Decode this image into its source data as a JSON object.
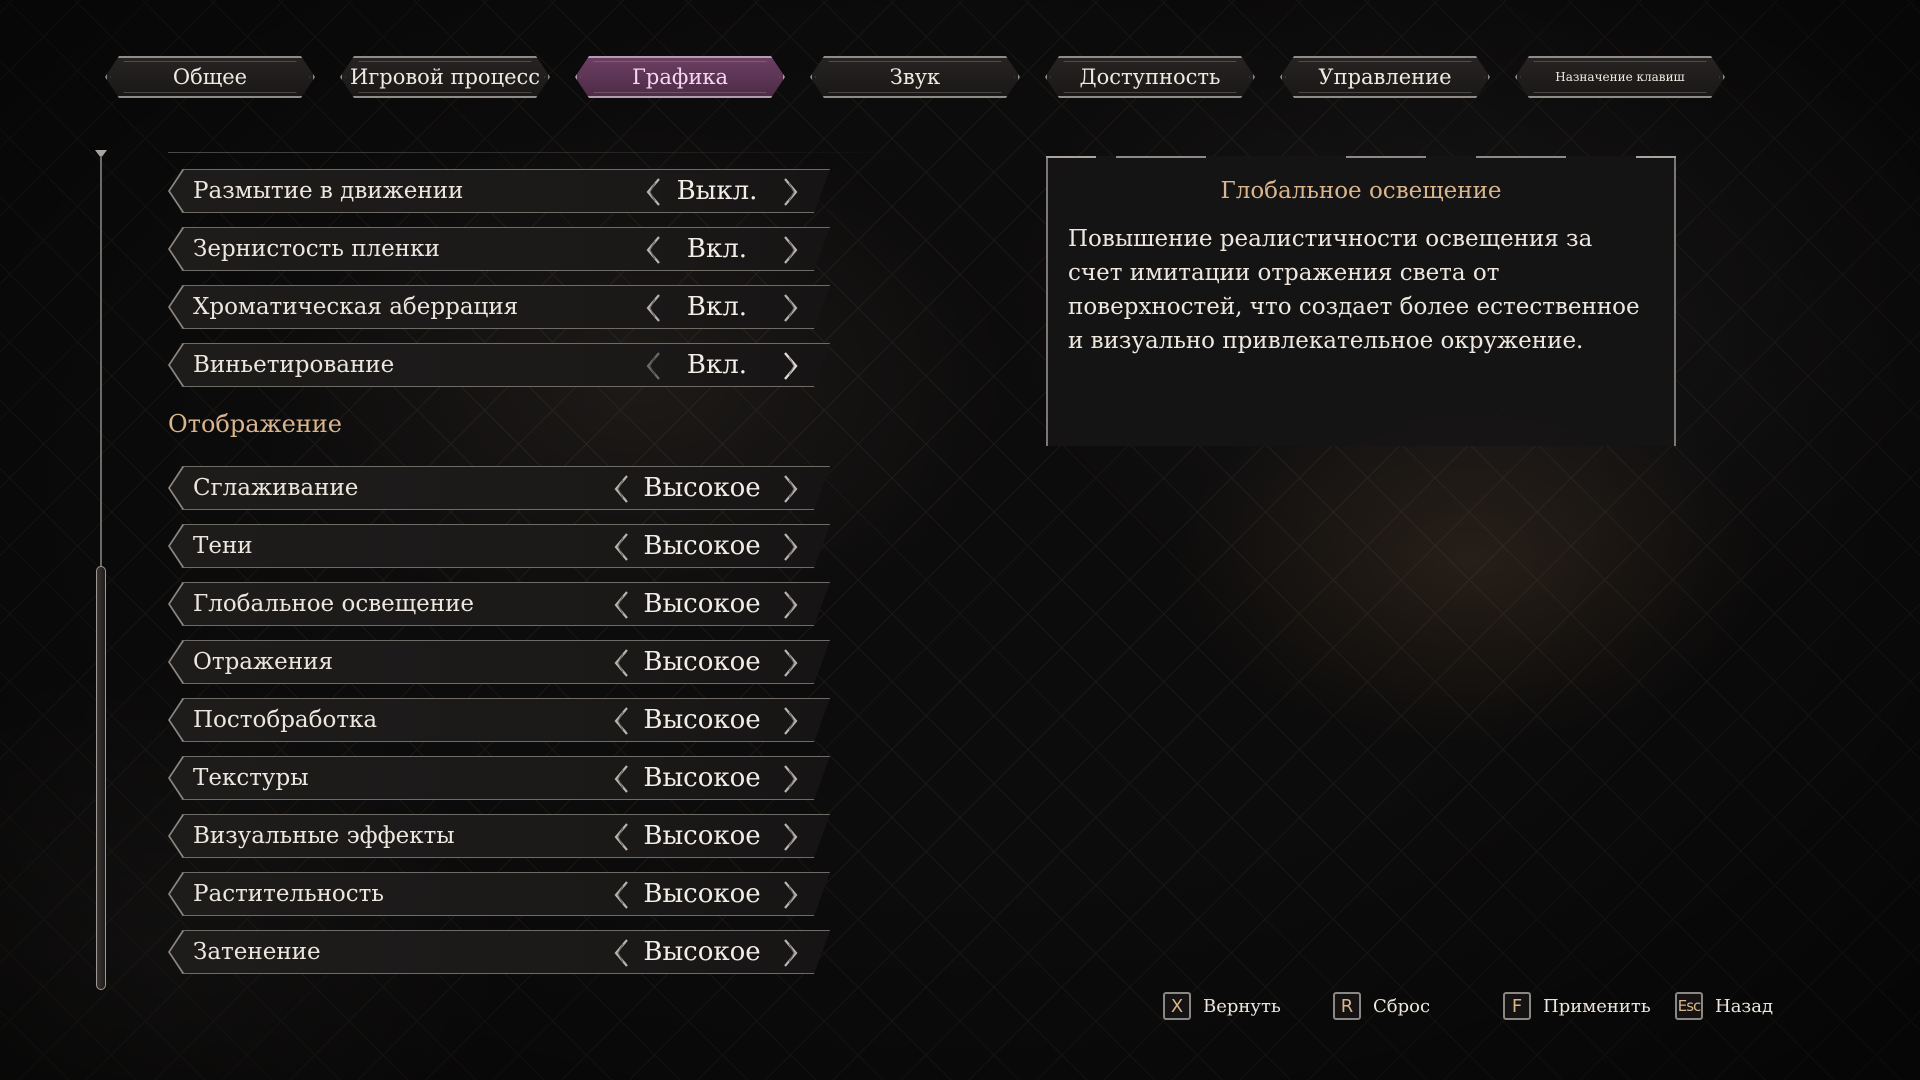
{
  "tabs": [
    {
      "label": "Общее",
      "active": false
    },
    {
      "label": "Игровой процесс",
      "active": false
    },
    {
      "label": "Графика",
      "active": true
    },
    {
      "label": "Звук",
      "active": false
    },
    {
      "label": "Доступность",
      "active": false
    },
    {
      "label": "Управление",
      "active": false
    },
    {
      "label": "Назначение клавиш",
      "active": false
    }
  ],
  "effects": [
    {
      "label": "Размытие в движении",
      "value": "Выкл."
    },
    {
      "label": "Зернистость пленки",
      "value": "Вкл."
    },
    {
      "label": "Хроматическая аберрация",
      "value": "Вкл."
    },
    {
      "label": "Виньетирование",
      "value": "Вкл."
    }
  ],
  "display_section": {
    "title": "Отображение"
  },
  "display": [
    {
      "label": "Сглаживание",
      "value": "Высокое"
    },
    {
      "label": "Тени",
      "value": "Высокое"
    },
    {
      "label": "Глобальное освещение",
      "value": "Высокое"
    },
    {
      "label": "Отражения",
      "value": "Высокое"
    },
    {
      "label": "Постобработка",
      "value": "Высокое"
    },
    {
      "label": "Текстуры",
      "value": "Высокое"
    },
    {
      "label": "Визуальные эффекты",
      "value": "Высокое"
    },
    {
      "label": "Растительность",
      "value": "Высокое"
    },
    {
      "label": "Затенение",
      "value": "Высокое"
    }
  ],
  "description": {
    "title": "Глобальное освещение",
    "body": "Повышение реалистичности освещения за счет имитации отражения света от поверхностей, что создает более естественное и визуально привлекательное окружение."
  },
  "footer": [
    {
      "key": "X",
      "label": "Вернуть"
    },
    {
      "key": "R",
      "label": "Сброс"
    },
    {
      "key": "F",
      "label": "Применить"
    },
    {
      "key": "Esc",
      "label": "Назад"
    }
  ],
  "colors": {
    "accent": "#d9b48c",
    "active_tab": "#5b3453",
    "background": "#0d0c0c",
    "row": "#1c1a19"
  },
  "icons": {
    "arrow_left": "chevron-left-icon",
    "arrow_right": "chevron-right-icon"
  }
}
